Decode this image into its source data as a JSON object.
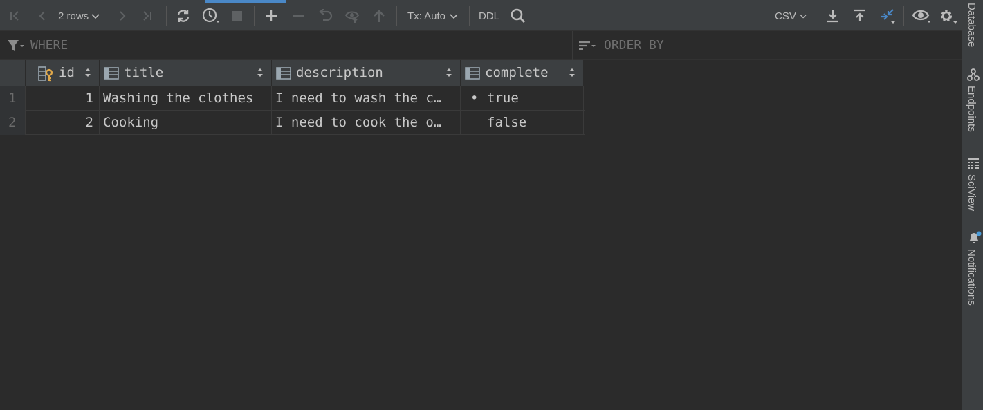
{
  "toolbar": {
    "rows_label": "2 rows",
    "tx_label": "Tx: Auto",
    "ddl_label": "DDL",
    "export_format": "CSV"
  },
  "filter": {
    "where_label": "WHERE",
    "order_by_label": "ORDER BY"
  },
  "table": {
    "columns": [
      {
        "name": "id",
        "icon": "primary-key-column-icon"
      },
      {
        "name": "title",
        "icon": "column-icon"
      },
      {
        "name": "description",
        "icon": "column-icon"
      },
      {
        "name": "complete",
        "icon": "column-icon"
      }
    ],
    "rows": [
      {
        "num": "1",
        "id": "1",
        "title": "Washing the clothes",
        "description": "I need to wash the c…",
        "complete_marker": "•",
        "complete": "true"
      },
      {
        "num": "2",
        "id": "2",
        "title": "Cooking",
        "description": "I need to cook the o…",
        "complete_marker": "",
        "complete": "false"
      }
    ]
  },
  "side_panel": {
    "database": "Database",
    "endpoints": "Endpoints",
    "sciview": "SciView",
    "notifications": "Notifications"
  },
  "colors": {
    "background": "#2b2b2b",
    "toolbar": "#3c3f41",
    "accent": "#4a88c7",
    "key_icon": "#e0a84a",
    "text": "#bbbbbb"
  }
}
